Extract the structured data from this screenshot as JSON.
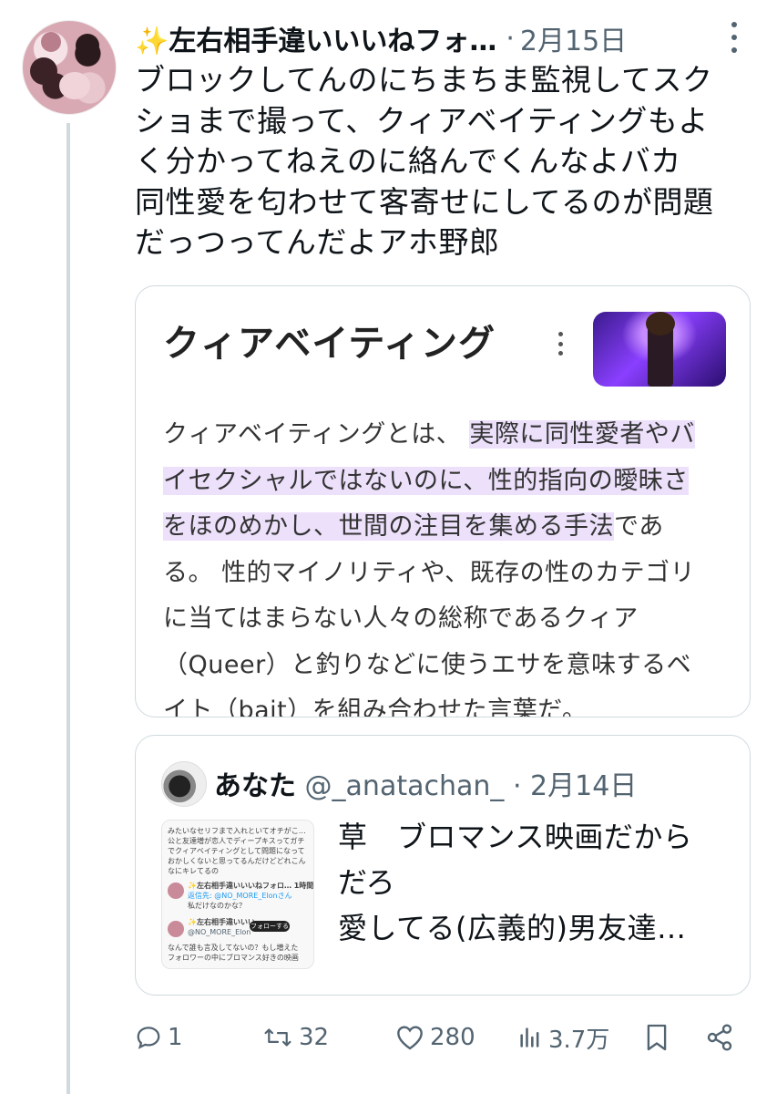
{
  "tweet": {
    "author_name": "✨左右相手違いいいねフォ…",
    "separator": "·",
    "date": "2月15日",
    "text_lines": [
      "ブロックしてんのにちまちま監視してスク",
      "ショまで撮って、クィアベイティングもよ",
      "く分かってねえのに絡んでくんなよバカ",
      "同性愛を匂わせて客寄せにしてるのが問題",
      "だっつってんだよアホ野郎"
    ]
  },
  "card": {
    "title": "クィアベイティング",
    "body_lines": [
      {
        "plain": "クィアベイティングとは、 ",
        "highlight": "実際に同性愛者やバ",
        "after": ""
      },
      {
        "plain": "",
        "highlight": "イセクシャルではないのに、性的指向の曖昧さ",
        "after": ""
      },
      {
        "plain": "",
        "highlight": "をほのめかし、世間の注目を集める手法",
        "after": "であ"
      },
      {
        "plain": "る。 性的マイノリティや、既存の性のカテゴリ",
        "highlight": "",
        "after": ""
      },
      {
        "plain": "に当てはまらない人々の総称であるクィア",
        "highlight": "",
        "after": ""
      },
      {
        "plain": "（Queer）と釣りなどに使うエサを意味するベ",
        "highlight": "",
        "after": ""
      },
      {
        "plain": "イト（bait）を組み合わせた言葉だ。",
        "highlight": "",
        "after": ""
      }
    ]
  },
  "quote": {
    "author_name": "あなた",
    "handle": "@_anatachan_",
    "separator": "·",
    "date": "2月14日",
    "text_lines": [
      "草　ブロマンス映画だから",
      "だろ",
      "愛してる(広義的)男友達…"
    ],
    "thumb": {
      "line1": "みたいなセリフまで入れといてオチがこ…",
      "line2": "公と友達増が恋人でディープキスってガチ",
      "line3": "でクィアベイティングとして問題になって",
      "line4": "おかしくないと思ってるんだけどどれこん",
      "line5": "なにキレてるの",
      "name1": "✨左右相手違いいいねフォロ… 1時間",
      "reply1": "返信先: @NO_MORE_Elonさん",
      "text1": "私だけなのかな？",
      "name2": "✨左右相手違いいい…",
      "handle2": "@NO_MORE_Elon",
      "follow": "フォローする",
      "text2a": "なんで誰も言及してないの？もし増えた",
      "text2b": "フォロワーの中にブロマンス好きの映画"
    }
  },
  "actions": {
    "reply_count": "1",
    "retweet_count": "32",
    "like_count": "280",
    "view_count": "3.7万"
  }
}
